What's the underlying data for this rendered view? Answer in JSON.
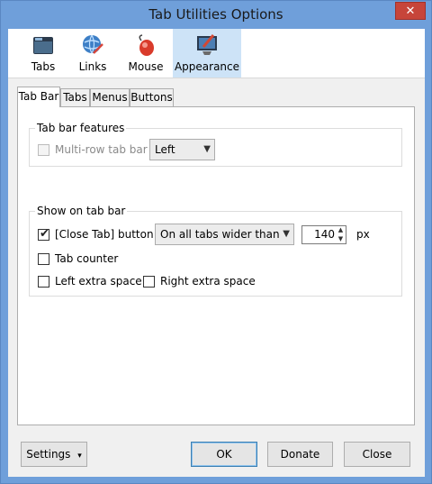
{
  "window": {
    "title": "Tab Utilities Options",
    "close_glyph": "✕"
  },
  "toolbar": {
    "items": [
      {
        "label": "Tabs",
        "icon": "folder-icon"
      },
      {
        "label": "Links",
        "icon": "globe-link-icon"
      },
      {
        "label": "Mouse",
        "icon": "mouse-icon"
      },
      {
        "label": "Appearance",
        "icon": "paint-monitor-icon"
      }
    ],
    "active": "Appearance"
  },
  "tabs": {
    "items": [
      "Tab Bar",
      "Tabs",
      "Menus",
      "Buttons"
    ],
    "active": "Tab Bar"
  },
  "tab_bar_features": {
    "title": "Tab bar features",
    "multirow_label": "Multi-row tab bar",
    "multirow_checked": false,
    "multirow_disabled": true,
    "position_value": "Left"
  },
  "show_on_tab_bar": {
    "title": "Show on tab bar",
    "close_tab_label": "[Close Tab] button",
    "close_tab_checked": true,
    "close_tab_mode": "On all tabs wider than",
    "width_value": "140",
    "width_unit": "px",
    "tab_counter_label": "Tab counter",
    "tab_counter_checked": false,
    "left_space_label": "Left extra space",
    "left_space_checked": false,
    "right_space_label": "Right extra space",
    "right_space_checked": false
  },
  "footer": {
    "settings_label": "Settings",
    "settings_arrow": "▾",
    "ok_label": "OK",
    "donate_label": "Donate",
    "close_label": "Close"
  },
  "colors": {
    "titlebar": "#6f9fda",
    "close": "#c7453a",
    "active_tool": "#cde3f7"
  }
}
